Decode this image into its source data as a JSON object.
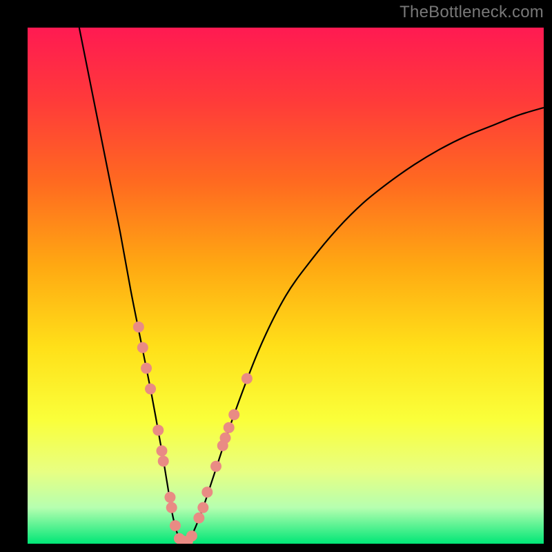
{
  "watermark": "TheBottleneck.com",
  "chart_data": {
    "type": "line",
    "title": "",
    "xlabel": "",
    "ylabel": "",
    "xlim": [
      0,
      100
    ],
    "ylim": [
      0,
      100
    ],
    "grid": false,
    "legend": false,
    "background_gradient": {
      "stops": [
        {
          "offset": 0.0,
          "color": "#ff1a52"
        },
        {
          "offset": 0.14,
          "color": "#ff3a3a"
        },
        {
          "offset": 0.3,
          "color": "#ff6a20"
        },
        {
          "offset": 0.46,
          "color": "#ffa812"
        },
        {
          "offset": 0.62,
          "color": "#ffe019"
        },
        {
          "offset": 0.76,
          "color": "#faff3a"
        },
        {
          "offset": 0.86,
          "color": "#e8ff82"
        },
        {
          "offset": 0.93,
          "color": "#b6ffb0"
        },
        {
          "offset": 1.0,
          "color": "#00e676"
        }
      ]
    },
    "series": [
      {
        "name": "bottleneck-curve",
        "color": "#000000",
        "x": [
          10,
          12,
          14,
          16,
          18,
          20,
          22,
          24,
          26,
          27,
          28,
          29,
          30,
          31,
          32,
          34,
          36,
          40,
          45,
          50,
          55,
          60,
          65,
          70,
          75,
          80,
          85,
          90,
          95,
          100
        ],
        "y": [
          100,
          90,
          80,
          70,
          60,
          49,
          39,
          29,
          18,
          12,
          6,
          2,
          0.5,
          0.5,
          2,
          7,
          13,
          25,
          38,
          48,
          55,
          61,
          66,
          70,
          73.5,
          76.5,
          79,
          81,
          83,
          84.5
        ]
      }
    ],
    "markers": {
      "name": "highlight-dots",
      "color": "#e98b84",
      "radius_px": 8,
      "points": [
        {
          "x": 21.5,
          "y": 42
        },
        {
          "x": 22.3,
          "y": 38
        },
        {
          "x": 23.0,
          "y": 34
        },
        {
          "x": 23.8,
          "y": 30
        },
        {
          "x": 25.3,
          "y": 22
        },
        {
          "x": 26.0,
          "y": 18
        },
        {
          "x": 26.3,
          "y": 16
        },
        {
          "x": 27.6,
          "y": 9
        },
        {
          "x": 27.9,
          "y": 7
        },
        {
          "x": 28.6,
          "y": 3.5
        },
        {
          "x": 29.4,
          "y": 1.0
        },
        {
          "x": 30.2,
          "y": 0.5
        },
        {
          "x": 31.0,
          "y": 0.5
        },
        {
          "x": 31.8,
          "y": 1.5
        },
        {
          "x": 33.2,
          "y": 5
        },
        {
          "x": 34.0,
          "y": 7
        },
        {
          "x": 34.8,
          "y": 10
        },
        {
          "x": 36.5,
          "y": 15
        },
        {
          "x": 37.8,
          "y": 19
        },
        {
          "x": 38.3,
          "y": 20.5
        },
        {
          "x": 39.0,
          "y": 22.5
        },
        {
          "x": 40.0,
          "y": 25
        },
        {
          "x": 42.5,
          "y": 32
        }
      ]
    }
  }
}
